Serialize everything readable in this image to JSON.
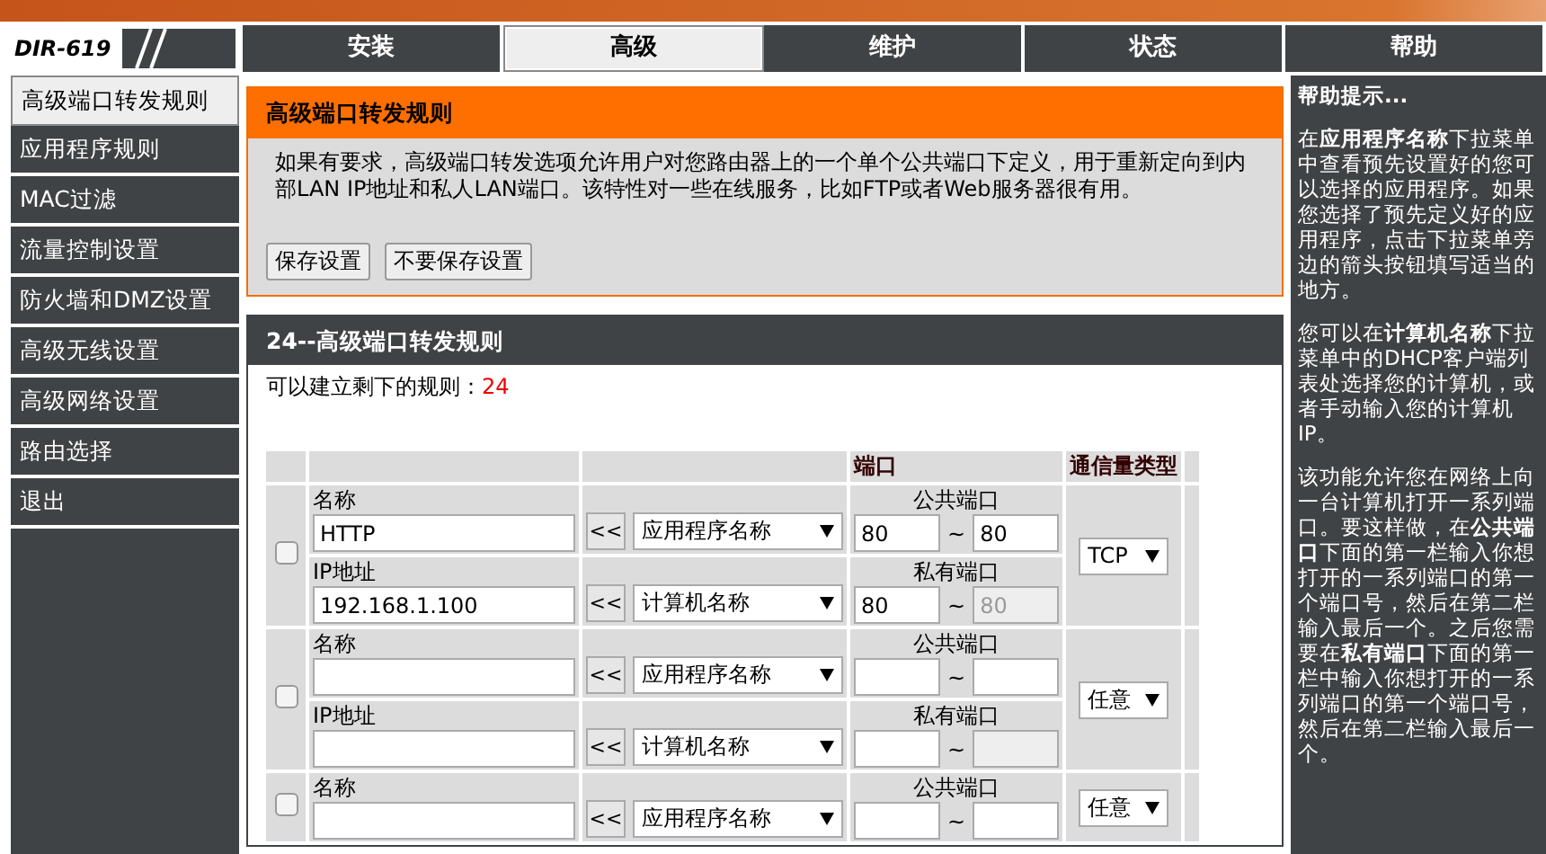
{
  "logo": {
    "text": "DIR-619"
  },
  "nav_tabs": [
    {
      "label": "安装",
      "selected": false
    },
    {
      "label": "高级",
      "selected": true
    },
    {
      "label": "维护",
      "selected": false
    },
    {
      "label": "状态",
      "selected": false
    },
    {
      "label": "帮助",
      "selected": false
    }
  ],
  "sidebar": {
    "items": [
      {
        "label": "高级端口转发规则",
        "selected": true
      },
      {
        "label": "应用程序规则",
        "selected": false
      },
      {
        "label": "MAC过滤",
        "selected": false
      },
      {
        "label": "流量控制设置",
        "selected": false
      },
      {
        "label": "防火墙和DMZ设置",
        "selected": false
      },
      {
        "label": "高级无线设置",
        "selected": false
      },
      {
        "label": "高级网络设置",
        "selected": false
      },
      {
        "label": "路由选择",
        "selected": false
      },
      {
        "label": "退出",
        "selected": false
      }
    ]
  },
  "intro": {
    "title": "高级端口转发规则",
    "text": "如果有要求，高级端口转发选项允许用户对您路由器上的一个单个公共端口下定义，用于重新定向到内部LAN IP地址和私人LAN端口。该特性对一些在线服务，比如FTP或者Web服务器很有用。",
    "buttons": [
      "保存设置",
      "不要保存设置"
    ]
  },
  "rules": {
    "title": "24--高级端口转发规则",
    "remaining_label": "可以建立剩下的规则：",
    "remaining_count": "24",
    "columns": {
      "port": "端口",
      "traffic_type": "通信量类型"
    },
    "rows": [
      {
        "checked": false,
        "name_label": "名称",
        "name": "HTTP",
        "copy_button": "<<",
        "app_select": "应用程序名称",
        "public_label": "公共端口",
        "public_start": "80",
        "tilde": "~",
        "public_end": "80",
        "traffic_type": "TCP",
        "ip_label": "IP地址",
        "ip": "192.168.1.100",
        "ip_copy_button": "<<",
        "computer_select": "计算机名称",
        "private_label": "私有端口",
        "private_start": "80",
        "private_tilde": "~",
        "private_end": "80"
      },
      {
        "checked": false,
        "name_label": "名称",
        "name": "",
        "copy_button": "<<",
        "app_select": "应用程序名称",
        "public_label": "公共端口",
        "public_start": "",
        "tilde": "~",
        "public_end": "",
        "traffic_type": "任意",
        "ip_label": "IP地址",
        "ip": "",
        "ip_copy_button": "<<",
        "computer_select": "计算机名称",
        "private_label": "私有端口",
        "private_start": "",
        "private_tilde": "~",
        "private_end": ""
      },
      {
        "checked": false,
        "name_label": "名称",
        "name": "",
        "copy_button": "<<",
        "app_select": "应用程序名称",
        "public_label": "公共端口",
        "public_start": "",
        "tilde": "~",
        "public_end": "",
        "traffic_type": "任意"
      }
    ]
  },
  "help": {
    "title": "帮助提示...",
    "paragraphs": [
      "在**应用程序名称**下拉菜单中查看预先设置好的您可以选择的应用程序。如果您选择了预先定义好的应用程序，点击下拉菜单旁边的箭头按钮填写适当的地方。",
      "您可以在**计算机名称**下拉菜单中的DHCP客户端列表处选择您的计算机，或者手动输入您的计算机IP。",
      "该功能允许您在网络上向一台计算机打开一系列端口。要这样做，在**公共端口**下面的第一栏输入你想打开的一系列端口的第一个端口号，然后在第二栏输入最后一个。之后您需要在**私有端口**下面的第一栏中输入你想打开的一系列端口的第一个端口号，然后在第二栏输入最后一个。"
    ]
  }
}
